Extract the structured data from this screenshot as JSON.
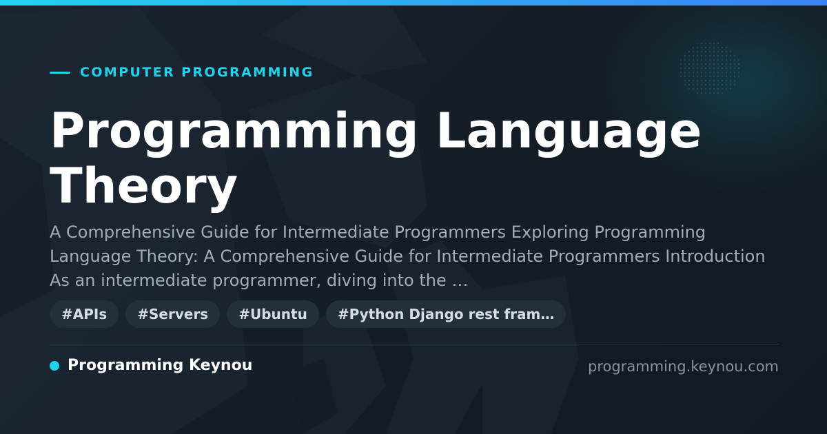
{
  "header": {
    "category": "COMPUTER PROGRAMMING"
  },
  "article": {
    "title": "Programming Language Theory",
    "description": "A Comprehensive Guide for Intermediate Programmers Exploring Programming Language Theory: A Comprehensive Guide for Intermediate Programmers Introduction As an intermediate programmer, diving into the …"
  },
  "tags": [
    "#APIs",
    "#Servers",
    "#Ubuntu",
    "#Python Django rest fram…"
  ],
  "footer": {
    "brand": "Programming Keynou",
    "url": "programming.keynou.com"
  },
  "colors": {
    "accent": "#22d3ee",
    "background": "#17202a",
    "title": "#ffffff",
    "description": "#a3adb8",
    "tag_background": "#26323e",
    "url": "#8793a0"
  }
}
